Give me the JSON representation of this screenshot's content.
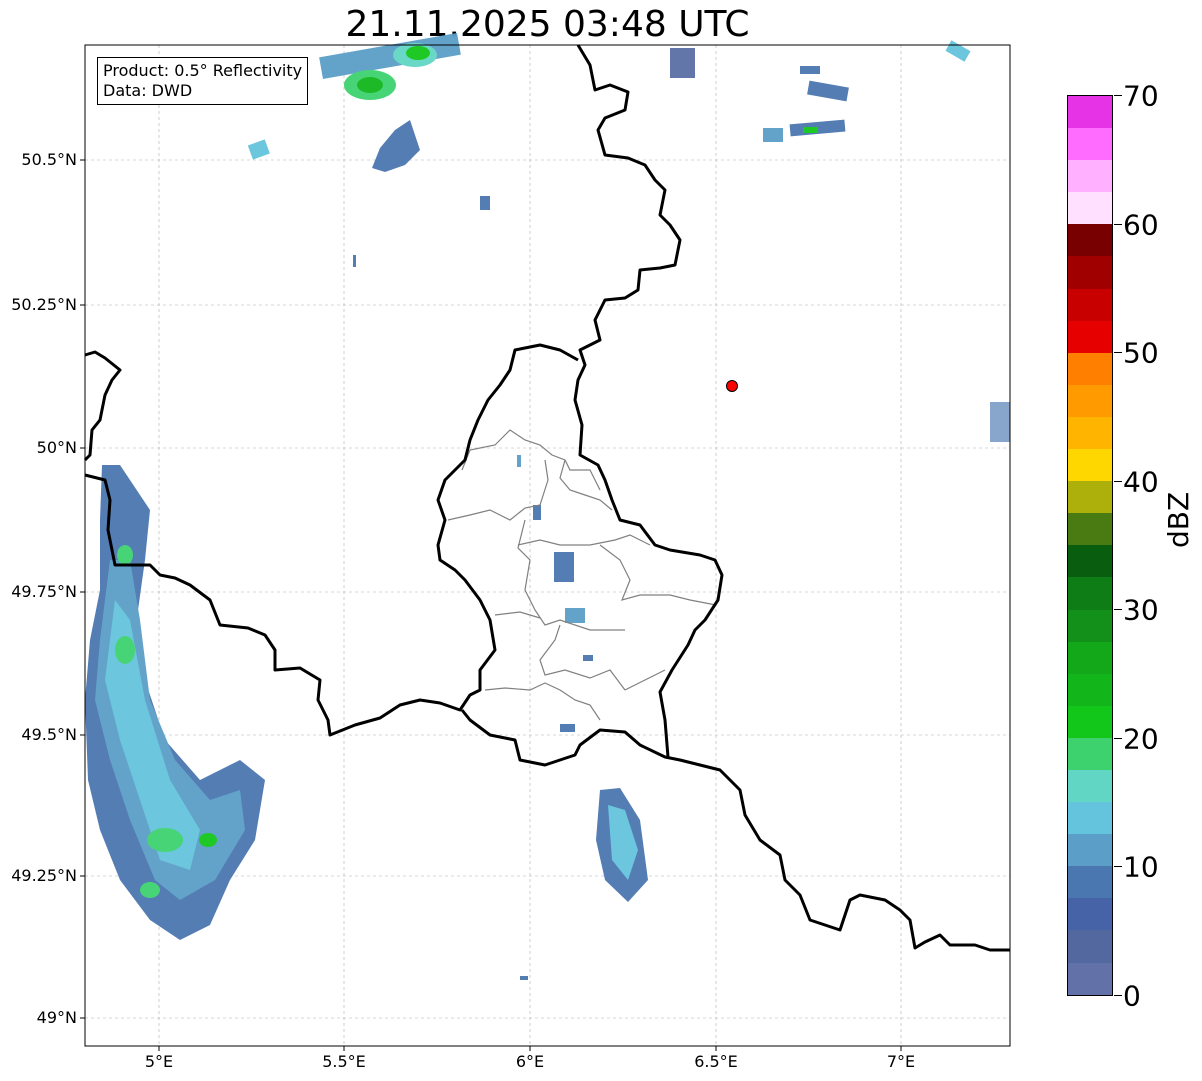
{
  "title": "21.11.2025 03:48 UTC",
  "product_box": {
    "line1": "Product: 0.5° Reflectivity",
    "line2": "Data: DWD"
  },
  "axes": {
    "lat_ticks": [
      "50.5°N",
      "50.25°N",
      "50°N",
      "49.75°N",
      "49.5°N",
      "49.25°N",
      "49°N"
    ],
    "lon_ticks": [
      "5°E",
      "5.5°E",
      "6°E",
      "6.5°E",
      "7°E"
    ]
  },
  "colorbar": {
    "label": "dBZ",
    "ticks": [
      "0",
      "10",
      "20",
      "30",
      "40",
      "50",
      "60",
      "70"
    ],
    "colors": [
      "#6271a8",
      "#53689e",
      "#4763a7",
      "#4b77b0",
      "#5b9fc8",
      "#64c3dd",
      "#62d6c4",
      "#3ed26f",
      "#12c61a",
      "#12b61b",
      "#12a81a",
      "#12901a",
      "#0e7d16",
      "#085d0f",
      "#4a7a12",
      "#adaf0a",
      "#ffd700",
      "#ffb400",
      "#ff9a00",
      "#ff7f00",
      "#e60000",
      "#c80000",
      "#a00000",
      "#780000",
      "#ffe0ff",
      "#ffb0ff",
      "#ff6cff",
      "#e633e6"
    ]
  },
  "map": {
    "bounds": {
      "lon_min": 4.8,
      "lon_max": 7.3,
      "lat_min": 48.95,
      "lat_max": 50.7
    },
    "marker": {
      "lon": 6.55,
      "lat": 50.11,
      "color": "#ff0000"
    },
    "legend_echo_color": "#4b77b0"
  }
}
